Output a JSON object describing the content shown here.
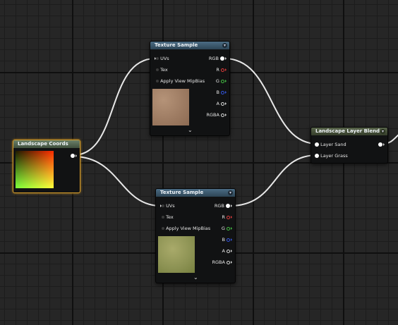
{
  "nodes": {
    "texture_sample_1": {
      "title": "Texture Sample",
      "inputs": [
        "UVs",
        "Tex",
        "Apply View MipBias"
      ],
      "outputs": [
        "RGB",
        "R",
        "G",
        "B",
        "A",
        "RGBA"
      ],
      "preview": "sand texture"
    },
    "texture_sample_2": {
      "title": "Texture Sample",
      "inputs": [
        "UVs",
        "Tex",
        "Apply View MipBias"
      ],
      "outputs": [
        "RGB",
        "R",
        "G",
        "B",
        "A",
        "RGBA"
      ],
      "preview": "grass texture"
    },
    "landscape_coords": {
      "title": "Landscape Coords"
    },
    "landscape_layer_blend": {
      "title": "Landscape Layer Blend",
      "inputs": [
        "Layer Sand",
        "Layer Grass"
      ]
    }
  },
  "colors": {
    "pin_r": "#e03b3b",
    "pin_g": "#45c245",
    "pin_b": "#3356e0",
    "selection": "#d29a2b",
    "wire": "#e8e8e8"
  }
}
